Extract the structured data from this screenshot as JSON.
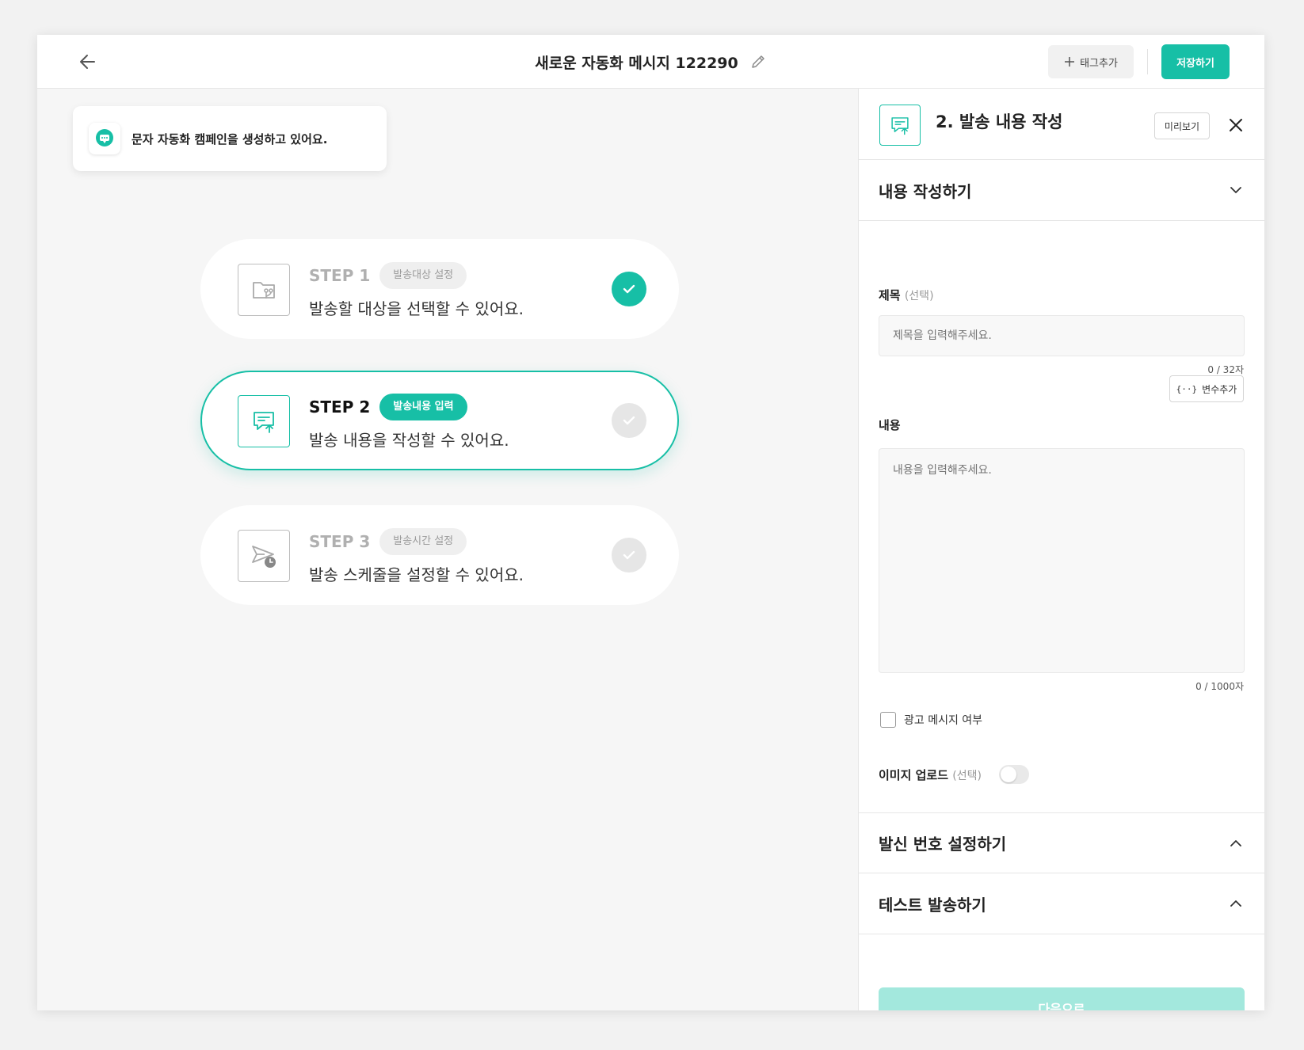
{
  "header": {
    "title": "새로운 자동화 메시지 122290",
    "tag_add_label": "태그추가",
    "save_label": "저장하기"
  },
  "toast": {
    "message": "문자 자동화 캠페인을 생성하고 있어요."
  },
  "steps": [
    {
      "title": "STEP 1",
      "badge": "발송대상 설정",
      "description": "발송할 대상을 선택할 수 있어요.",
      "status": "done",
      "icon": "folder-branch-icon"
    },
    {
      "title": "STEP 2",
      "badge": "발송내용 입력",
      "description": "발송 내용을 작성할 수 있어요.",
      "status": "active",
      "icon": "message-upload-icon"
    },
    {
      "title": "STEP 3",
      "badge": "발송시간 설정",
      "description": "발송 스케줄을 설정할 수 있어요.",
      "status": "pending",
      "icon": "send-clock-icon"
    }
  ],
  "panel": {
    "title": "2. 발송 내용 작성",
    "preview_label": "미리보기",
    "sections": {
      "content": "내용 작성하기",
      "sender": "발신 번호 설정하기",
      "test": "테스트 발송하기"
    },
    "subject": {
      "label": "제목",
      "optional": "(선택)",
      "placeholder": "제목을 입력해주세요.",
      "counter": "0 / 32자"
    },
    "body": {
      "label": "내용",
      "var_add_label": "변수추가",
      "placeholder": "내용을 입력해주세요.",
      "counter": "0 / 1000자"
    },
    "ad_checkbox_label": "광고 메시지 여부",
    "image_upload": {
      "label": "이미지 업로드",
      "optional": "(선택)"
    },
    "next_label": "다음으로"
  },
  "colors": {
    "accent": "#17bfa6",
    "accent_disabled": "#a3e8dd"
  }
}
